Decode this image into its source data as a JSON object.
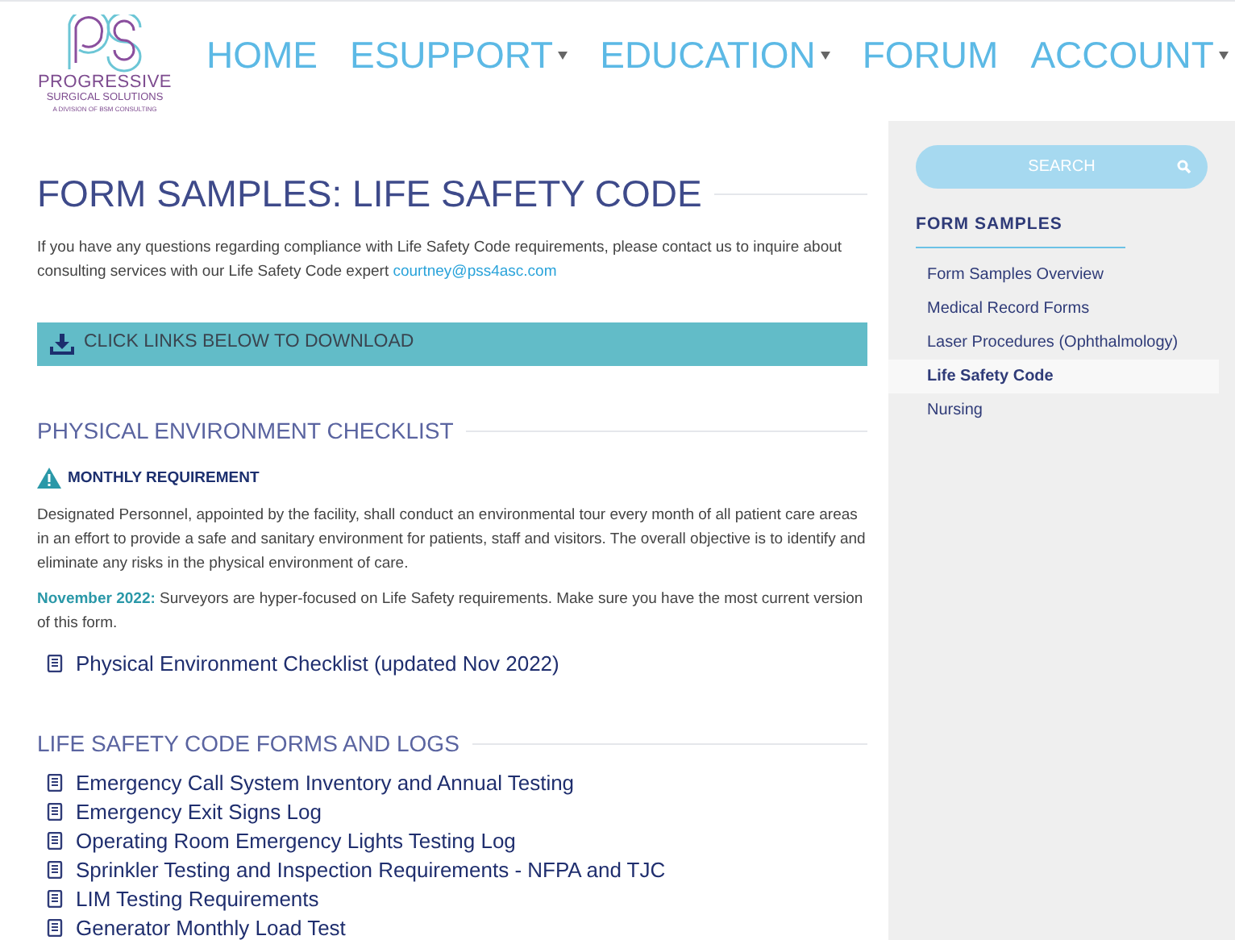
{
  "logo": {
    "name": "PROGRESSIVE",
    "subname": "SURGICAL SOLUTIONS",
    "tagline": "A DIVISION OF BSM CONSULTING"
  },
  "nav": [
    {
      "label": "HOME",
      "has_menu": false
    },
    {
      "label": "ESUPPORT",
      "has_menu": true
    },
    {
      "label": "EDUCATION",
      "has_menu": true
    },
    {
      "label": "FORUM",
      "has_menu": false
    },
    {
      "label": "ACCOUNT",
      "has_menu": true
    }
  ],
  "page_title": "FORM SAMPLES: LIFE SAFETY CODE",
  "intro": {
    "text": "If you have any questions regarding compliance with Life Safety Code requirements, please contact us to inquire about consulting services with our Life Safety Code expert ",
    "email": "courtney@pss4asc.com"
  },
  "download_banner": "CLICK LINKS BELOW TO DOWNLOAD",
  "sections": [
    {
      "heading": "PHYSICAL ENVIRONMENT CHECKLIST",
      "alert": "MONTHLY REQUIREMENT",
      "description": "Designated Personnel, appointed by the facility, shall conduct an environmental tour every month of all patient care areas in an effort to provide a safe and sanitary environment for patients, staff and visitors. The overall objective is to identify and eliminate any risks in the physical environment of care.",
      "note": {
        "lead": "November 2022:",
        "text": " Surveyors are hyper-focused on Life Safety requirements. Make sure you have the most current version of this form."
      },
      "links": [
        "Physical Environment Checklist (updated Nov 2022)"
      ]
    },
    {
      "heading": "LIFE SAFETY CODE FORMS AND LOGS",
      "links": [
        "Emergency Call System Inventory and Annual Testing",
        "Emergency Exit Signs Log",
        "Operating Room Emergency Lights Testing Log",
        "Sprinkler Testing and Inspection Requirements - NFPA and TJC",
        "LIM Testing Requirements",
        "Generator Monthly Load Test"
      ]
    }
  ],
  "sidebar": {
    "search": {
      "placeholder": "SEARCH"
    },
    "heading": "FORM SAMPLES",
    "items": [
      {
        "label": "Form Samples Overview",
        "selected": false
      },
      {
        "label": "Medical Record Forms",
        "selected": false
      },
      {
        "label": "Laser Procedures (Ophthalmology)",
        "selected": false
      },
      {
        "label": "Life Safety Code",
        "selected": true
      },
      {
        "label": "Nursing",
        "selected": false
      }
    ]
  }
}
